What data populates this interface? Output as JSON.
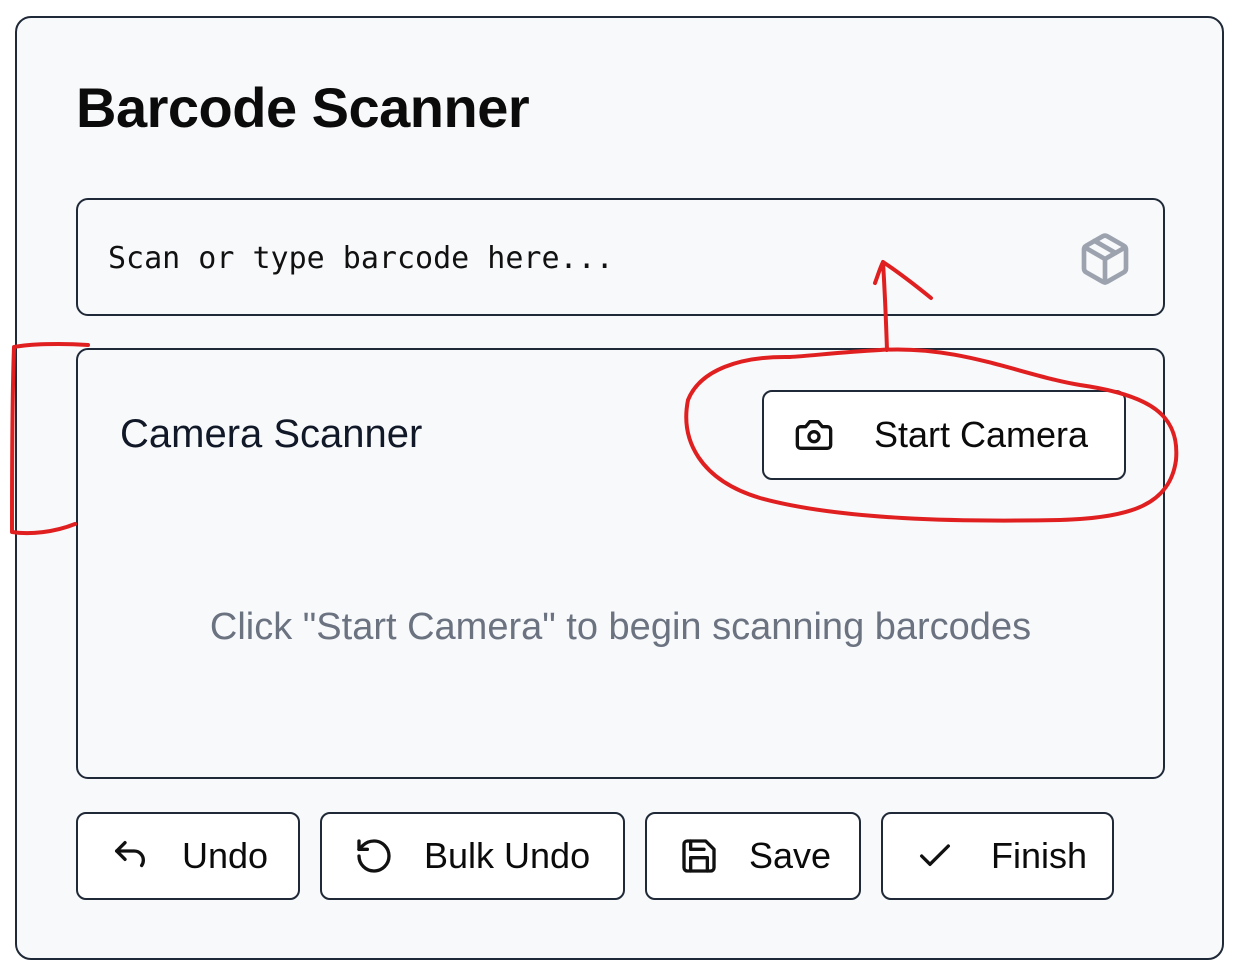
{
  "header": {
    "title": "Barcode Scanner"
  },
  "barcode_input": {
    "placeholder": "Scan or type barcode here...",
    "value": "",
    "icon": "package-icon"
  },
  "camera_scanner": {
    "title": "Camera Scanner",
    "start_button_label": "Start Camera",
    "start_button_icon": "camera-icon",
    "hint": "Click \"Start Camera\" to begin scanning barcodes"
  },
  "actions": {
    "undo_label": "Undo",
    "bulk_undo_label": "Bulk Undo",
    "save_label": "Save",
    "finish_label": "Finish"
  },
  "annotation": {
    "color": "#e02020"
  }
}
